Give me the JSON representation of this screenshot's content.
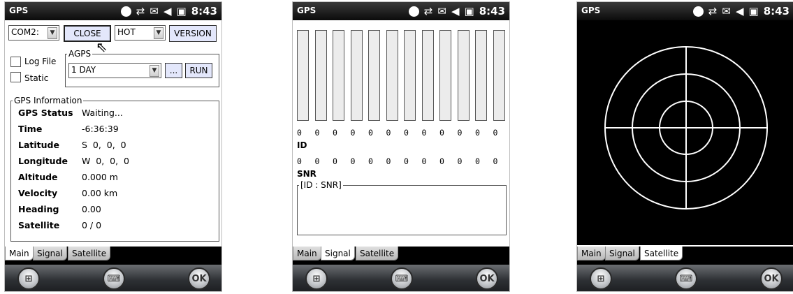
{
  "status_bar": {
    "title": "GPS",
    "time": "8:43",
    "icons": [
      "status-dot-icon",
      "connectivity-icon",
      "message-icon",
      "volume-icon",
      "battery-icon"
    ]
  },
  "tabs": [
    "Main",
    "Signal",
    "Satellite"
  ],
  "softkeys": {
    "left": "windows-start-icon",
    "center": "keyboard-icon",
    "right": "OK"
  },
  "main": {
    "port_value": "COM2:",
    "close_label": "CLOSE",
    "start_mode_value": "HOT",
    "version_label": "VERSION",
    "log_file_label": "Log File",
    "static_label": "Static",
    "agps_group_title": "AGPS",
    "agps_period_value": "1 DAY",
    "browse_label": "...",
    "run_label": "RUN",
    "info_group_title": "GPS Information",
    "info": [
      {
        "label": "GPS Status",
        "value": "Waiting..."
      },
      {
        "label": "Time",
        "value": "-6:36:39"
      },
      {
        "label": "Latitude",
        "value": "S  0,  0,  0"
      },
      {
        "label": "Longitude",
        "value": "W  0,  0,  0"
      },
      {
        "label": "Altitude",
        "value": "0.000 m"
      },
      {
        "label": "Velocity",
        "value": "0.00 km"
      },
      {
        "label": "Heading",
        "value": "0.00"
      },
      {
        "label": "Satellite",
        "value": "0 / 0"
      }
    ]
  },
  "signal": {
    "ids": [
      "0",
      "0",
      "0",
      "0",
      "0",
      "0",
      "0",
      "0",
      "0",
      "0",
      "0",
      "0"
    ],
    "id_label": "ID",
    "snrs": [
      "0",
      "0",
      "0",
      "0",
      "0",
      "0",
      "0",
      "0",
      "0",
      "0",
      "0",
      "0"
    ],
    "snr_label": "SNR",
    "list_group_title": "[ID : SNR]",
    "bar_levels": [
      0,
      0,
      0,
      0,
      0,
      0,
      0,
      0,
      0,
      0,
      0,
      0
    ]
  },
  "colors": {
    "button_blue": "#e3e7fb",
    "sky_background": "#000000",
    "sky_grid": "#ffffff"
  }
}
